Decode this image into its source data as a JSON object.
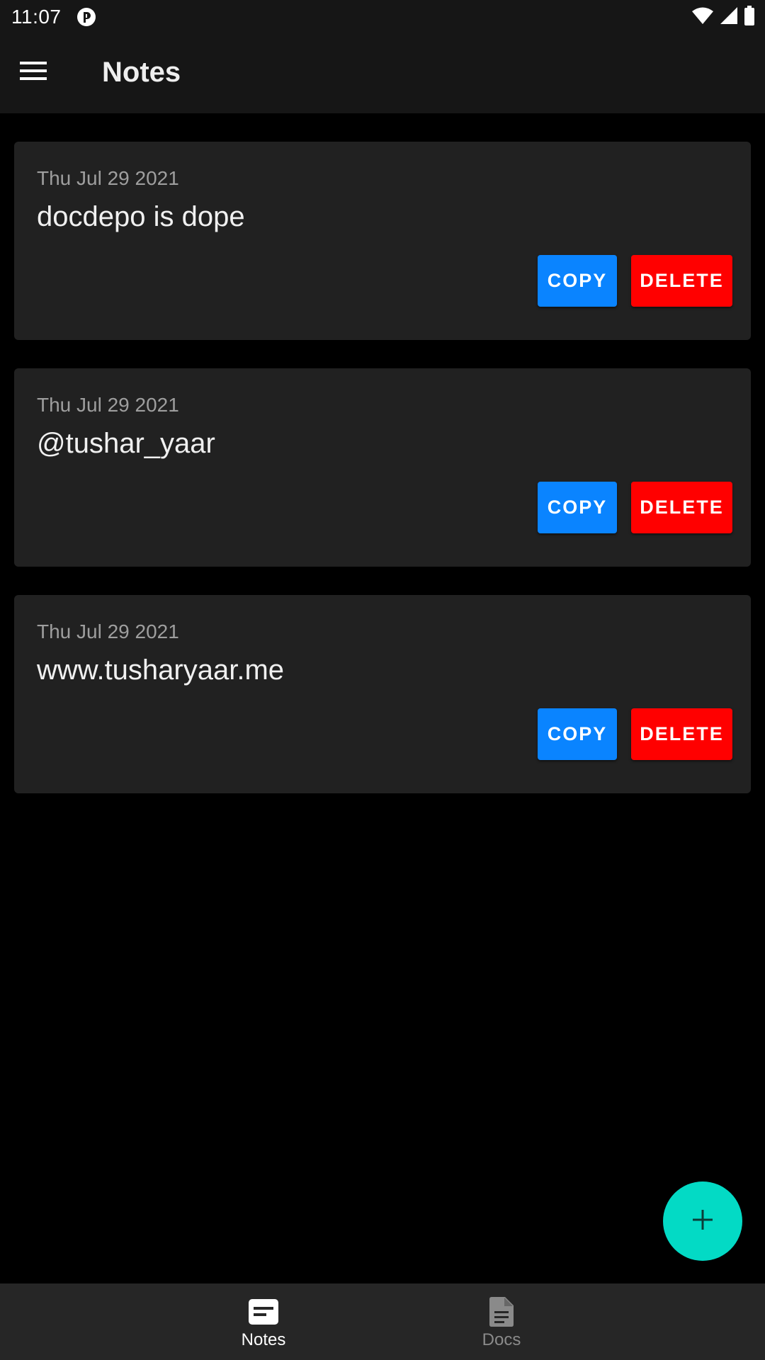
{
  "status_bar": {
    "time": "11:07",
    "icons": [
      "app-notification-icon",
      "wifi-icon",
      "cell-signal-icon",
      "battery-icon"
    ]
  },
  "app_bar": {
    "menu_icon": "hamburger-menu-icon",
    "title": "Notes"
  },
  "notes": [
    {
      "date": "Thu Jul 29 2021",
      "text": "docdepo is dope",
      "copy_label": "COPY",
      "delete_label": "DELETE"
    },
    {
      "date": "Thu Jul 29 2021",
      "text": "@tushar_yaar",
      "copy_label": "COPY",
      "delete_label": "DELETE"
    },
    {
      "date": "Thu Jul 29 2021",
      "text": "www.tusharyaar.me",
      "copy_label": "COPY",
      "delete_label": "DELETE"
    }
  ],
  "fab": {
    "icon": "plus-icon"
  },
  "bottom_nav": {
    "items": [
      {
        "label": "Notes",
        "icon": "notes-icon",
        "active": true
      },
      {
        "label": "Docs",
        "icon": "document-icon",
        "active": false
      }
    ]
  },
  "colors": {
    "background": "#000000",
    "bar_background": "#161616",
    "card_background": "#212121",
    "copy_button": "#0a84ff",
    "delete_button": "#ff0000",
    "fab": "#03dac5",
    "bottom_nav": "#262626"
  }
}
